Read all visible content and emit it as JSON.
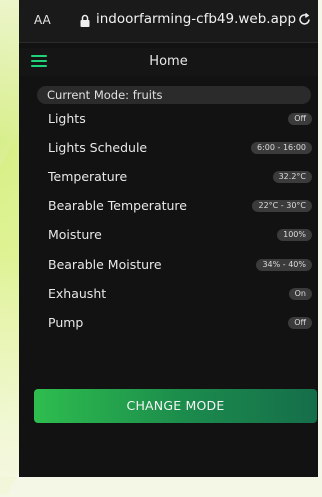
{
  "browser": {
    "text_size_label": "AA",
    "url": "indoorfarming-cfb49.web.app"
  },
  "header": {
    "title": "Home"
  },
  "mode": {
    "label": "Current Mode: fruits"
  },
  "rows": [
    {
      "label": "Lights",
      "value": "Off"
    },
    {
      "label": "Lights Schedule",
      "value": "6:00 - 16:00"
    },
    {
      "label": "Temperature",
      "value": "32.2°C"
    },
    {
      "label": "Bearable Temperature",
      "value": "22°C - 30°C"
    },
    {
      "label": "Moisture",
      "value": "100%"
    },
    {
      "label": "Bearable Moisture",
      "value": "34% - 40%"
    },
    {
      "label": "Exhausht",
      "value": "On"
    },
    {
      "label": "Pump",
      "value": "Off"
    }
  ],
  "actions": {
    "change_mode_label": "CHANGE MODE"
  },
  "colors": {
    "accent": "#1fd37a",
    "button_start": "#2ebd4e",
    "button_end": "#156e4a",
    "background": "#121212"
  },
  "icons": {
    "menu": "hamburger-menu-icon",
    "lock": "lock-icon",
    "reload": "reload-icon"
  }
}
